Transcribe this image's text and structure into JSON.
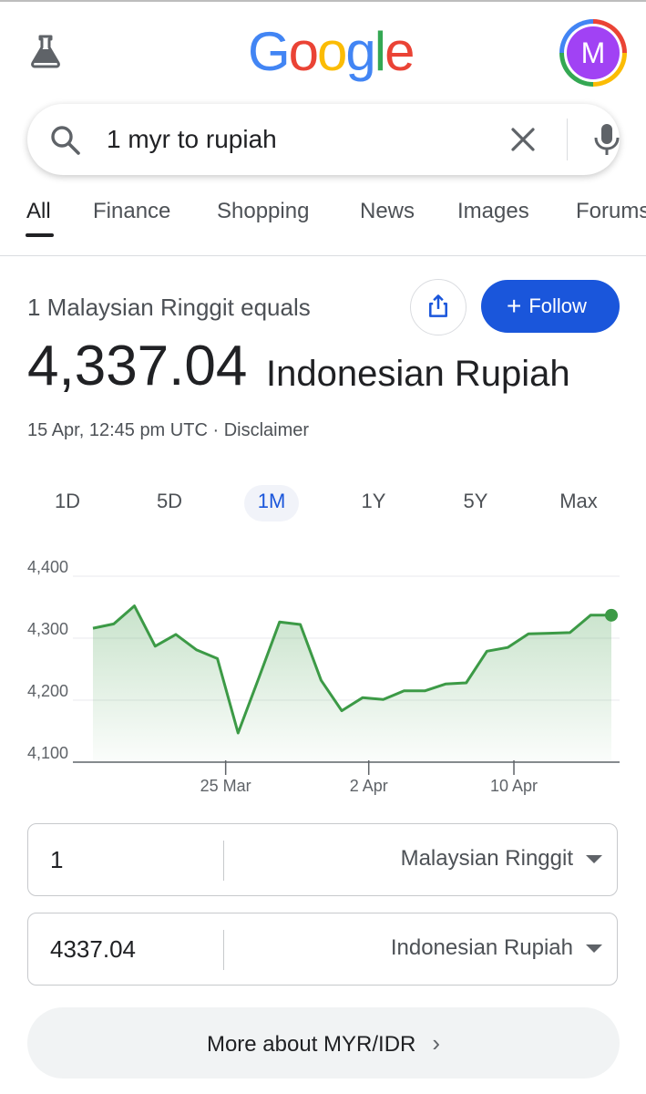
{
  "header": {
    "logo_letters": [
      {
        "ch": "G",
        "color": "#4285f4"
      },
      {
        "ch": "o",
        "color": "#ea4335"
      },
      {
        "ch": "o",
        "color": "#fbbc05"
      },
      {
        "ch": "g",
        "color": "#4285f4"
      },
      {
        "ch": "l",
        "color": "#34a853"
      },
      {
        "ch": "e",
        "color": "#ea4335"
      }
    ],
    "avatar_letter": "M",
    "avatar_color": "#a142f4",
    "labs_icon": "flask-icon"
  },
  "search": {
    "query": "1 myr to rupiah",
    "icons": [
      "search-icon",
      "close-icon",
      "mic-icon"
    ]
  },
  "tabs": [
    {
      "label": "All",
      "active": true
    },
    {
      "label": "Finance"
    },
    {
      "label": "Shopping"
    },
    {
      "label": "News"
    },
    {
      "label": "Images"
    },
    {
      "label": "Forums"
    }
  ],
  "result": {
    "equals_text": "1 Malaysian Ringgit equals",
    "value": "4,337.04",
    "unit": "Indonesian Rupiah",
    "timestamp": "15 Apr, 12:45 pm UTC",
    "separator": "·",
    "disclaimer": "Disclaimer",
    "follow_label": "Follow",
    "accent_color": "#1a56db"
  },
  "ranges": [
    {
      "label": "1D"
    },
    {
      "label": "5D"
    },
    {
      "label": "1M",
      "active": true
    },
    {
      "label": "1Y"
    },
    {
      "label": "5Y"
    },
    {
      "label": "Max"
    }
  ],
  "chart_data": {
    "type": "area",
    "title": "",
    "xlabel": "",
    "ylabel": "",
    "ylim": [
      4100,
      4400
    ],
    "yticks": [
      "4,400",
      "4,300",
      "4,200",
      "4,100"
    ],
    "ytick_values": [
      4400,
      4300,
      4200,
      4100
    ],
    "xticks": [
      "25 Mar",
      "2 Apr",
      "10 Apr"
    ],
    "line_color": "#3c9a46",
    "grid": true,
    "series": [
      {
        "values": [
          4316,
          4323,
          4352,
          4287,
          4306,
          4281,
          4267,
          4147,
          4236,
          4326,
          4322,
          4232,
          4183,
          4204,
          4201,
          4215,
          4215,
          4226,
          4228,
          4279,
          4285,
          4307,
          4308,
          4309,
          4337,
          4337
        ]
      }
    ]
  },
  "converter": {
    "from_amount": "1",
    "from_currency": "Malaysian Ringgit",
    "to_amount": "4337.04",
    "to_currency": "Indonesian Rupiah"
  },
  "more_label": "More about MYR/IDR"
}
